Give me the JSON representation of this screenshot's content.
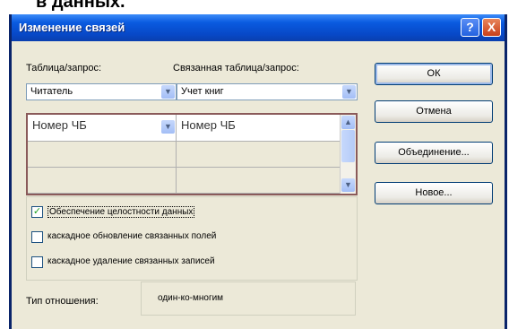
{
  "background_title_fragment": "в данных.",
  "window": {
    "title": "Изменение связей",
    "help_label": "?",
    "close_label": "X"
  },
  "labels": {
    "table_query": "Таблица/запрос:",
    "related_table_query": "Связанная таблица/запрос:"
  },
  "combos": {
    "table_value": "Читатель",
    "related_value": "Учет книг"
  },
  "grid": {
    "rows": [
      [
        "Номер ЧБ",
        "Номер ЧБ"
      ],
      [
        "",
        ""
      ],
      [
        "",
        ""
      ]
    ]
  },
  "checkboxes": [
    {
      "label": "Обеспечение целостности данных",
      "checked": true
    },
    {
      "label": "каскадное обновление связанных полей",
      "checked": false
    },
    {
      "label": "каскадное удаление связанных записей",
      "checked": false
    }
  ],
  "relationship": {
    "label": "Тип отношения:",
    "value": "один-ко-многим"
  },
  "buttons": {
    "ok": "ОК",
    "cancel": "Отмена",
    "join": "Объединение...",
    "new": "Новое..."
  },
  "icons": {
    "dropdown": "chevron-down-icon",
    "scroll_up": "arrow-up-icon",
    "scroll_down": "arrow-down-icon",
    "check": "check-icon"
  },
  "colors": {
    "titlebar": "#0a5be0",
    "dialog_bg": "#ece9d8",
    "close_button": "#c9401a",
    "check_mark": "#21a121"
  }
}
